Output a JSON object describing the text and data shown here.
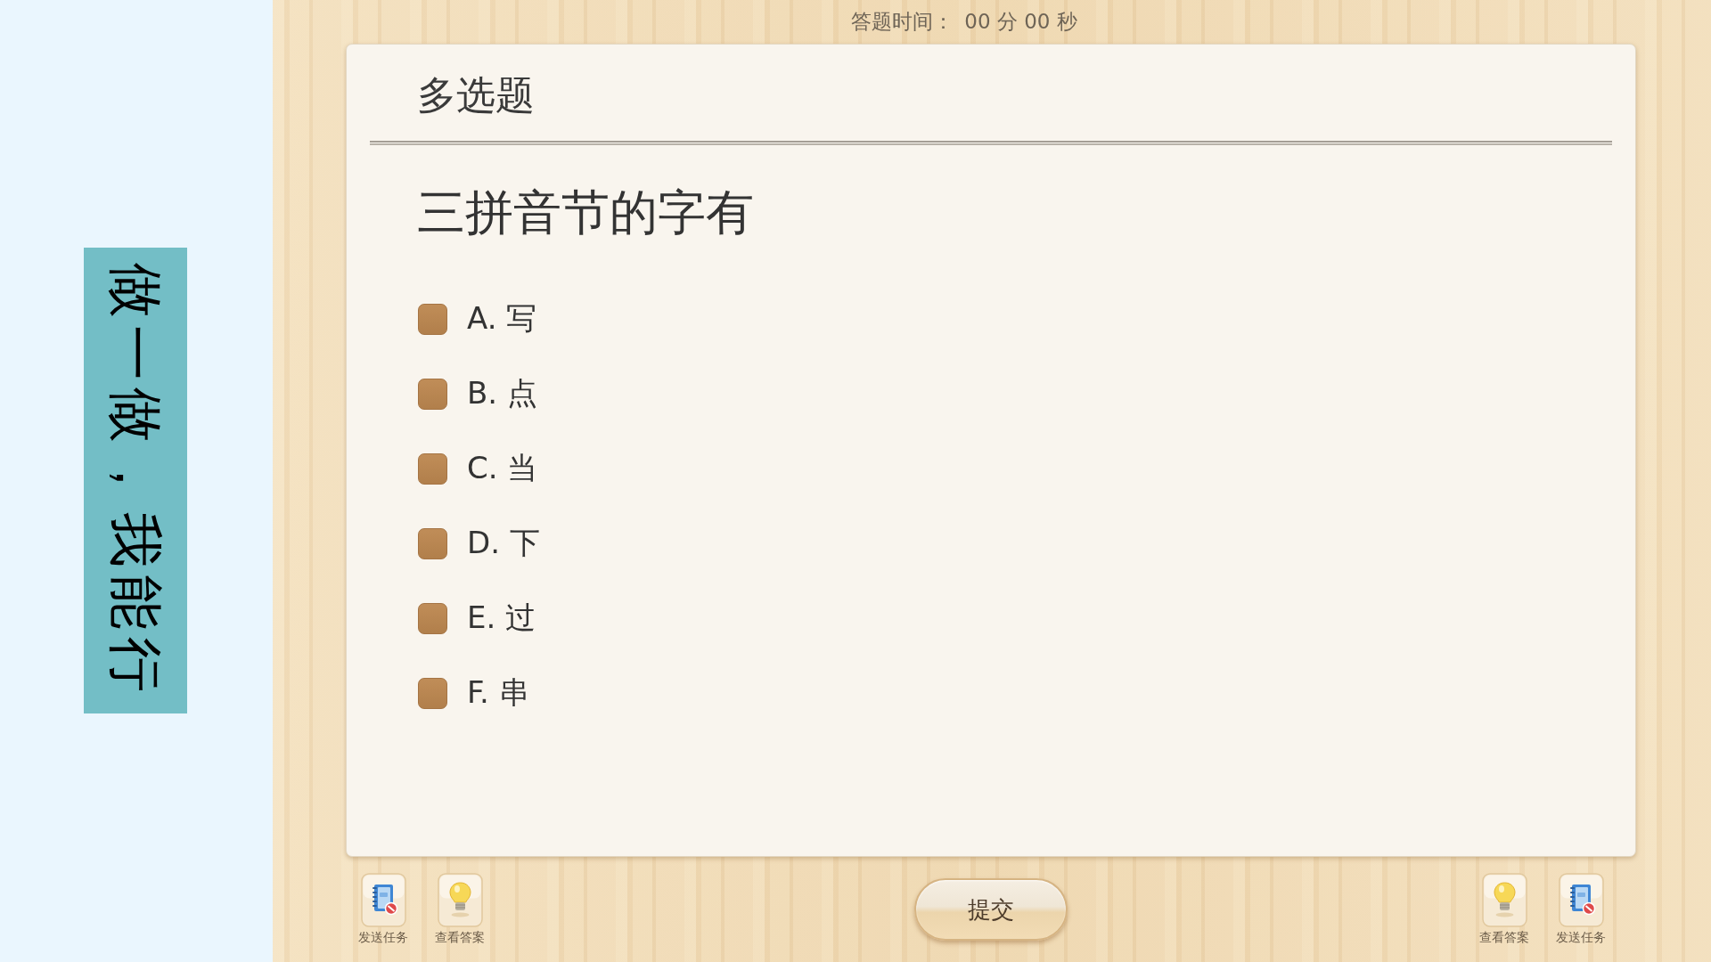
{
  "sidebar": {
    "banner": "做一做，我能行"
  },
  "timer": {
    "label": "答题时间：",
    "value": "00 分 00 秒"
  },
  "question_card": {
    "type_title": "多选题",
    "question": "三拼音节的字有",
    "options": [
      {
        "label": "A. 写",
        "checked": false
      },
      {
        "label": "B. 点",
        "checked": false
      },
      {
        "label": "C. 当",
        "checked": false
      },
      {
        "label": "D. 下",
        "checked": false
      },
      {
        "label": "E. 过",
        "checked": false
      },
      {
        "label": "F. 串",
        "checked": false
      }
    ]
  },
  "footer": {
    "left_tools": [
      {
        "kind": "send_task",
        "label": "发送任务"
      },
      {
        "kind": "view_answer",
        "label": "查看答案"
      }
    ],
    "submit": "提交",
    "right_tools": [
      {
        "kind": "view_answer",
        "label": "查看答案"
      },
      {
        "kind": "send_task",
        "label": "发送任务"
      }
    ]
  }
}
